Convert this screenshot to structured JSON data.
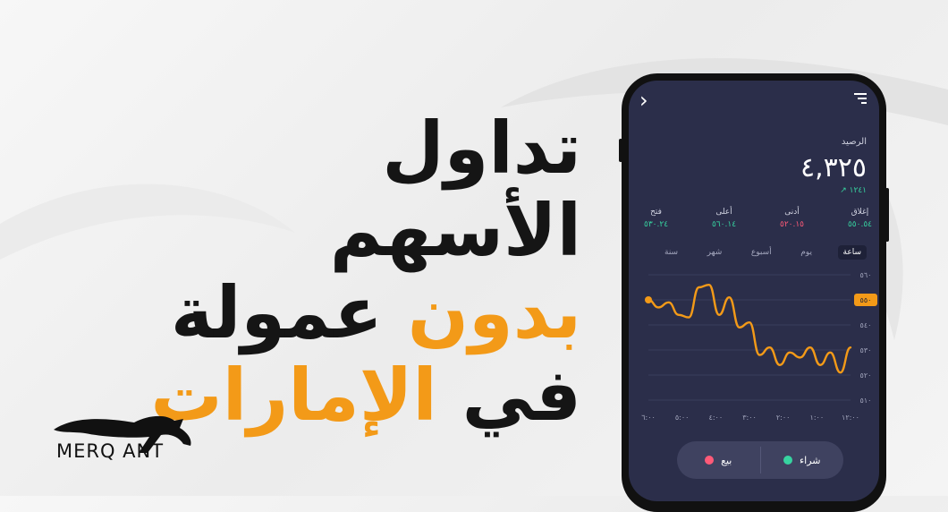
{
  "headline": {
    "line1": "تداول",
    "line2": "الأسهم",
    "line3_accent": "بدون",
    "line3_rest": "عمولة",
    "line4_rest": "في",
    "line4_accent": "الإمارات"
  },
  "brand": {
    "logo_text": "MERQ ANT"
  },
  "colors": {
    "accent": "#f39a18",
    "screen_bg": "#2b2e4a",
    "positive": "#37d3a0",
    "negative": "#ff5a78"
  },
  "app": {
    "back_icon": "chevron-left-icon",
    "menu_icon": "hamburger-menu-icon",
    "balance_label": "الرصيد",
    "balance_value": "٤,٣٢٥",
    "balance_change": "١٢٤١ ↗",
    "stats": [
      {
        "label": "إغلاق",
        "value": "٥٥٠.٥٤",
        "color": "positive"
      },
      {
        "label": "أدنى",
        "value": "٥٢٠.١٥",
        "color": "negative"
      },
      {
        "label": "أعلى",
        "value": "٥٦٠.١٤",
        "color": "positive"
      },
      {
        "label": "فتح",
        "value": "٥٣٠.٢٤",
        "color": "positive"
      }
    ],
    "tabs": [
      "ساعة",
      "يوم",
      "أسبوع",
      "شهر",
      "سنة"
    ],
    "active_tab": "ساعة",
    "buy_label": "شراء",
    "sell_label": "بيع"
  },
  "chart_data": {
    "type": "line",
    "y_ticks": [
      "٥٦٠",
      "٥٥٠",
      "٥٤٠",
      "٥٣٠",
      "٥٢٠",
      "٥١٠"
    ],
    "x_ticks": [
      "٦:٠٠",
      "٥:٠٠",
      "٤:٠٠",
      "٣:٠٠",
      "٢:٠٠",
      "١:٠٠",
      "١٢:٠٠"
    ],
    "highlight_label": "٥٥٠",
    "ylim": [
      510,
      560
    ],
    "x": [
      0,
      0.6,
      1.2,
      1.8,
      2.4,
      3.0,
      3.6,
      4.2,
      4.8,
      5.4,
      6.0,
      6.6,
      7.2,
      7.8,
      8.4,
      9.0,
      9.6,
      10.2,
      10.8,
      11.4,
      12
    ],
    "values": [
      550,
      547,
      549,
      544,
      543,
      555,
      556,
      544,
      551,
      539,
      541,
      528,
      531,
      524,
      529,
      527,
      531,
      524,
      529,
      521,
      531
    ],
    "series_color": "#f39a18"
  }
}
